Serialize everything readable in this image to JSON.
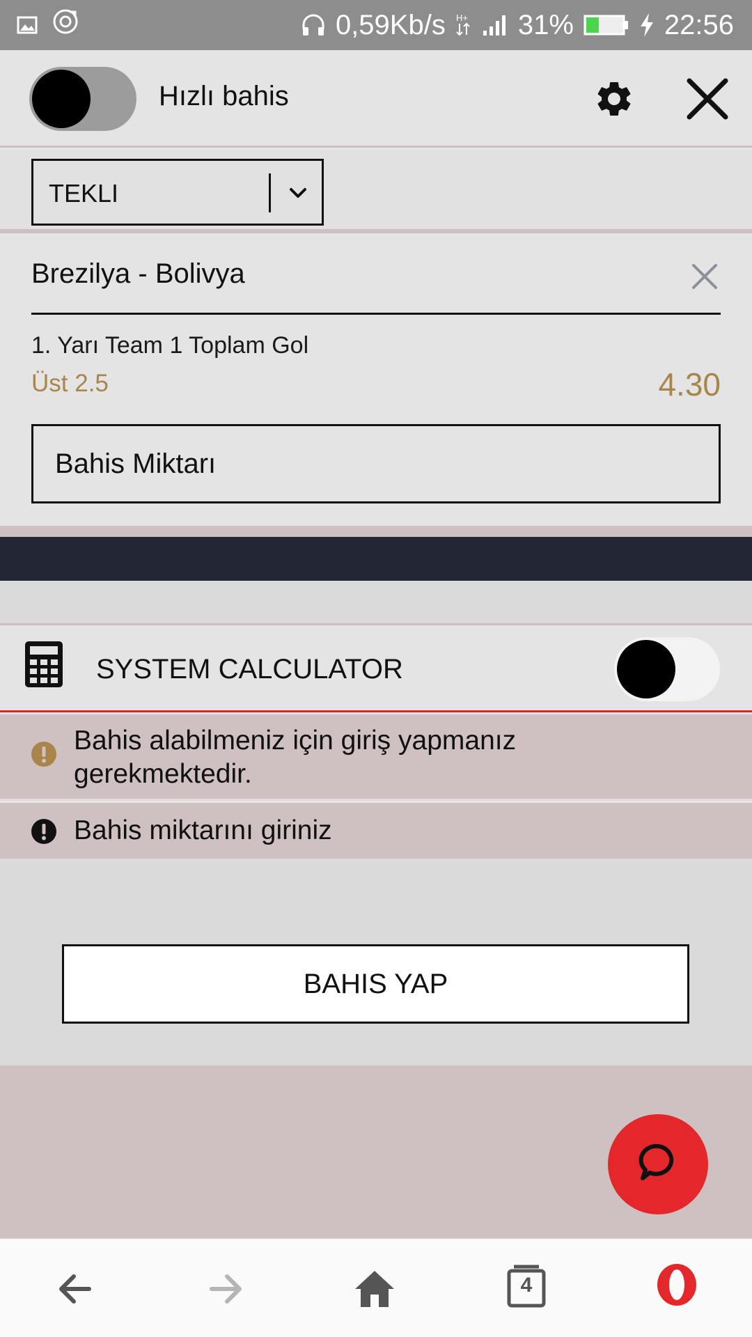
{
  "status_bar": {
    "network_speed": "0,59Kb/s",
    "battery": "31%",
    "time": "22:56",
    "icons": [
      "image-icon",
      "sync-icon",
      "headphones-icon",
      "hplus-network-icon",
      "signal-icon",
      "battery-icon",
      "charging-icon"
    ]
  },
  "header": {
    "quick_bet_label": "Hızlı bahis",
    "quick_bet_on": false,
    "icons": [
      "gear-icon",
      "close-icon"
    ]
  },
  "bet_type": {
    "selected": "TEKLI"
  },
  "bet_item": {
    "match": "Brezilya - Bolivya",
    "market": "1. Yarı Team 1 Toplam Gol",
    "selection": "Üst 2.5",
    "odds": "4.30",
    "stake_placeholder": "Bahis Miktarı"
  },
  "system_calculator": {
    "label": "SYSTEM CALCULATOR",
    "enabled": false
  },
  "warnings": [
    {
      "text": "Bahis alabilmeniz için giriş yapmanız gerekmektedir.",
      "color": "#a8864a"
    },
    {
      "text": "Bahis miktarını giriniz",
      "color": "#111111"
    }
  ],
  "place_bet_label": "BAHIS YAP",
  "nav_bar": {
    "tabs_count": "4",
    "icons": [
      "back-arrow-icon",
      "forward-arrow-icon",
      "home-icon",
      "tabs-icon",
      "opera-icon"
    ]
  },
  "colors": {
    "accent_gold": "#a8864a",
    "fab_red": "#e3272b",
    "dark_band": "#232635",
    "warning_bg": "#cfc0c1"
  }
}
